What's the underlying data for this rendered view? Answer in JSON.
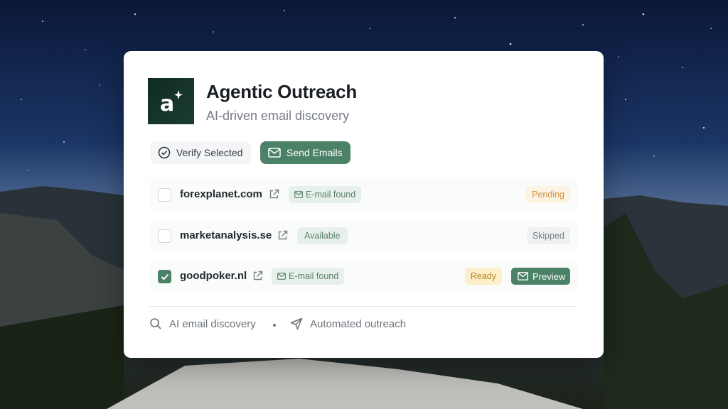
{
  "app": {
    "title": "Agentic Outreach",
    "subtitle": "AI-driven email discovery",
    "logo_icon": "sparkle-a-logo"
  },
  "toolbar": {
    "verify_label": "Verify Selected",
    "send_label": "Send Emails"
  },
  "rows": [
    {
      "domain": "forexplanet.com",
      "tag": "E-mail found",
      "tag_icon": "mail-icon",
      "status": "Pending",
      "checked": false
    },
    {
      "domain": "marketanalysis.se",
      "tag": "Available",
      "status": "Skipped",
      "checked": false
    },
    {
      "domain": "goodpoker.nl",
      "tag": "E-mail found",
      "tag_icon": "mail-icon",
      "status": "Ready",
      "checked": true,
      "action": "Preview"
    }
  ],
  "footer": {
    "item1": "AI email discovery",
    "item2": "Automated outreach"
  },
  "colors": {
    "accent": "#4b8267",
    "pending": "#d3913f",
    "ready": "#b48424"
  }
}
